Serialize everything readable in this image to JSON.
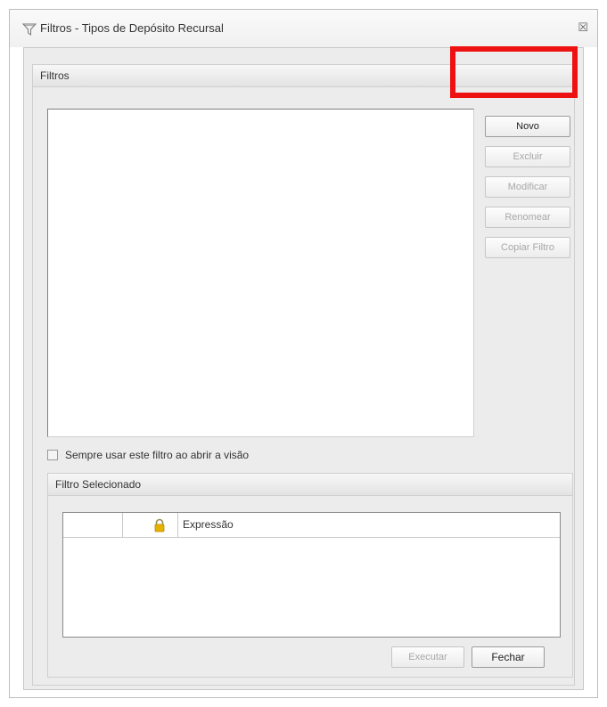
{
  "window": {
    "title": "Filtros - Tipos de Depósito Recursal",
    "close_glyph": "☒"
  },
  "filtros_group": {
    "title": "Filtros",
    "buttons": {
      "novo": "Novo",
      "excluir": "Excluir",
      "modificar": "Modificar",
      "renomear": "Renomear",
      "copiar": "Copiar Filtro"
    },
    "checkbox_label": "Sempre usar este filtro ao abrir a visão",
    "checkbox_checked": false
  },
  "selected_group": {
    "title": "Filtro Selecionado",
    "columns": [
      "",
      "",
      "Expressão"
    ],
    "buttons": {
      "executar": "Executar",
      "fechar": "Fechar"
    }
  },
  "icons": {
    "title": "filter-funnel-icon",
    "lock": "lock-icon",
    "close": "close-icon"
  },
  "colors": {
    "highlight": "#ee1111",
    "lock": "#e6b200"
  }
}
